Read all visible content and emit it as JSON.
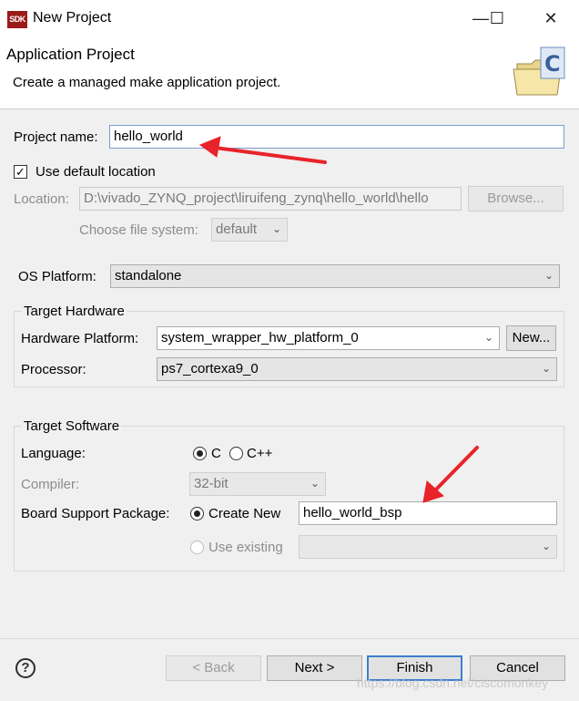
{
  "window": {
    "icon_text": "SDK",
    "title": "New Project",
    "minimize": "—",
    "maximize": "☐",
    "close": "✕"
  },
  "header": {
    "title": "Application Project",
    "description": "Create a managed make application project."
  },
  "project": {
    "name_label": "Project name:",
    "name_value": "hello_world",
    "use_default_label": "Use default location",
    "use_default_checked": true,
    "location_label": "Location:",
    "location_value": "D:\\vivado_ZYNQ_project\\liruifeng_zynq\\hello_world\\hello",
    "browse_label": "Browse...",
    "filesystem_label": "Choose file system:",
    "filesystem_value": "default",
    "os_label": "OS Platform:",
    "os_value": "standalone"
  },
  "target_hardware": {
    "title": "Target Hardware",
    "platform_label": "Hardware Platform:",
    "platform_value": "system_wrapper_hw_platform_0",
    "new_label": "New...",
    "processor_label": "Processor:",
    "processor_value": "ps7_cortexa9_0"
  },
  "target_software": {
    "title": "Target Software",
    "language_label": "Language:",
    "lang_c": "C",
    "lang_cpp": "C++",
    "compiler_label": "Compiler:",
    "compiler_value": "32-bit",
    "bsp_label": "Board Support Package:",
    "create_new_label": "Create New",
    "bsp_value": "hello_world_bsp",
    "use_existing_label": "Use existing"
  },
  "footer": {
    "help": "?",
    "back": "< Back",
    "next": "Next >",
    "finish": "Finish",
    "cancel": "Cancel",
    "watermark": "https://blog.csdn.net/ciscomonkey"
  },
  "colors": {
    "annotation_arrow": "#e8232a",
    "focus_border": "#3c7fd1"
  }
}
